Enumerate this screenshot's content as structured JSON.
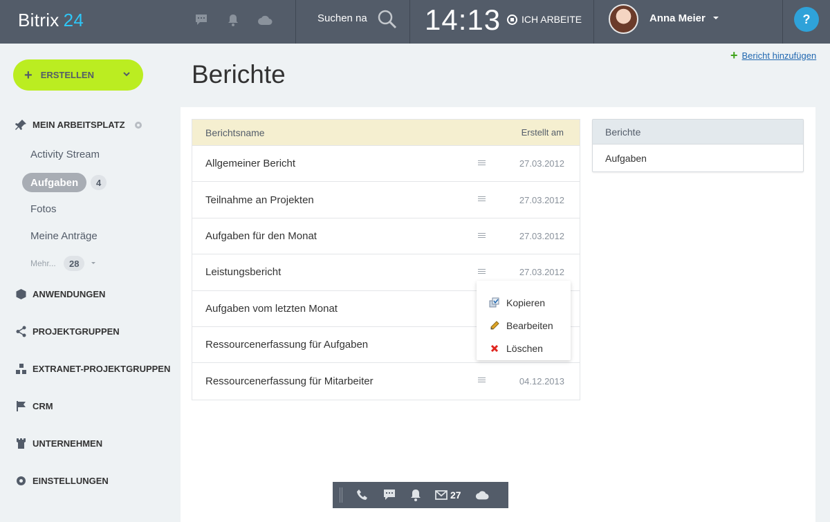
{
  "header": {
    "logo_text": "Bitrix",
    "logo_number": "24",
    "search_label": "Suchen na",
    "clock": "14:13",
    "work_status": "ICH ARBEITE",
    "user_name": "Anna Meier",
    "help_label": "?"
  },
  "sidebar": {
    "create_label": "ERSTELLEN",
    "workspace_label": "MEIN ARBEITSPLATZ",
    "workspace_items": {
      "activity": "Activity Stream",
      "tasks": "Aufgaben",
      "tasks_count": "4",
      "photos": "Fotos",
      "requests": "Meine Anträge",
      "more": "Mehr...",
      "more_count": "28"
    },
    "sections": {
      "apps": "ANWENDUNGEN",
      "groups": "PROJEKTGRUPPEN",
      "extranet": "EXTRANET-PROJEKTGRUPPEN",
      "crm": "CRM",
      "company": "UNTERNEHMEN",
      "settings": "EINSTELLUNGEN"
    }
  },
  "main": {
    "add_report": "Bericht hinzufügen",
    "title": "Berichte",
    "table": {
      "col_name": "Berichtsname",
      "col_date": "Erstellt am",
      "rows": [
        {
          "name": "Allgemeiner Bericht",
          "date": "27.03.2012"
        },
        {
          "name": "Teilnahme an Projekten",
          "date": "27.03.2012"
        },
        {
          "name": "Aufgaben für den Monat",
          "date": "27.03.2012"
        },
        {
          "name": "Leistungsbericht",
          "date": "27.03.2012"
        },
        {
          "name": "Aufgaben vom letzten Monat",
          "date": ""
        },
        {
          "name": "Ressourcenerfassung für Aufgaben",
          "date": ""
        },
        {
          "name": "Ressourcenerfassung für Mitarbeiter",
          "date": "04.12.2013"
        }
      ]
    },
    "popup": {
      "copy": "Kopieren",
      "edit": "Bearbeiten",
      "delete": "Löschen"
    },
    "side_panel": {
      "header": "Berichte",
      "item": "Aufgaben"
    }
  },
  "bottom_bar": {
    "mail_count": "27"
  }
}
